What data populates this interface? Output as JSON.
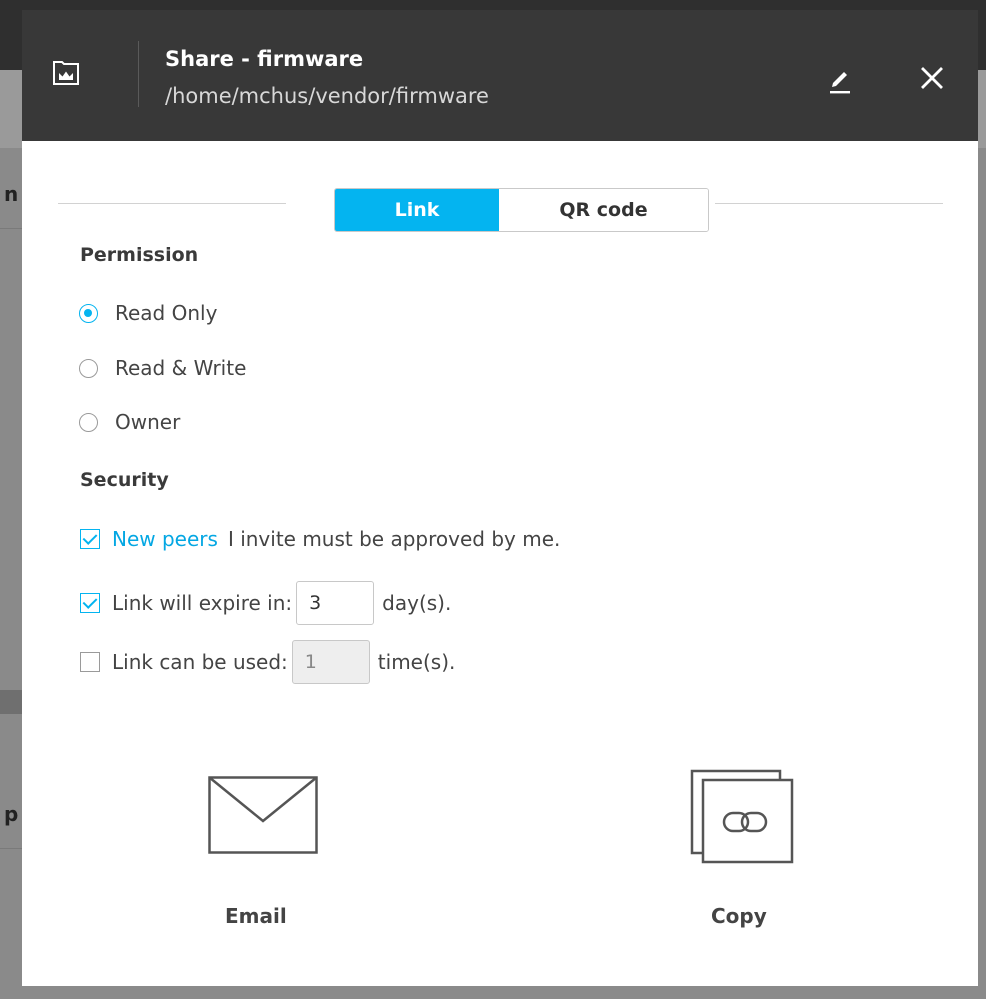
{
  "header": {
    "title": "Share - firmware",
    "path": "/home/mchus/vendor/firmware"
  },
  "tabs": [
    {
      "label": "Link",
      "active": true
    },
    {
      "label": "QR code",
      "active": false
    }
  ],
  "permission": {
    "heading": "Permission",
    "options": [
      {
        "label": "Read Only",
        "checked": true
      },
      {
        "label": "Read & Write",
        "checked": false
      },
      {
        "label": "Owner",
        "checked": false
      }
    ]
  },
  "security": {
    "heading": "Security",
    "approve": {
      "link_text": "New peers",
      "text": "I invite must be approved by me.",
      "checked": true
    },
    "expire": {
      "label": "Link will expire in:",
      "value": "3",
      "suffix": "day(s).",
      "checked": true
    },
    "uses": {
      "label": "Link can be used:",
      "value": "1",
      "suffix": "time(s).",
      "checked": false
    }
  },
  "actions": {
    "email_label": "Email",
    "copy_label": "Copy"
  },
  "colors": {
    "accent": "#04b4f0",
    "header_bg": "#383838"
  },
  "icons": {
    "folder": "folder-crown-icon",
    "edit": "pencil-icon",
    "close": "close-icon",
    "email": "envelope-icon",
    "copy": "copy-link-icon"
  }
}
